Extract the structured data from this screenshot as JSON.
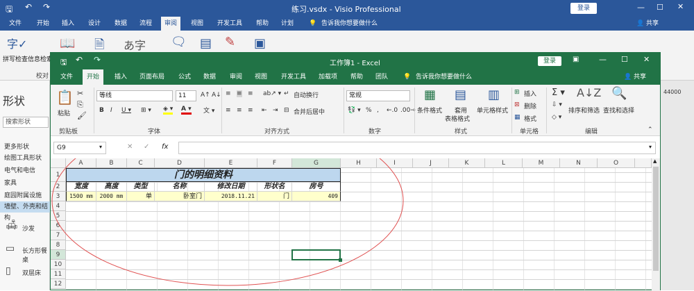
{
  "visio": {
    "title": "练习.vsdx - Visio Professional",
    "login": "登录",
    "share": "共享",
    "tell_me": "告诉我你想要做什么",
    "tabs": [
      "文件",
      "开始",
      "插入",
      "设计",
      "数据",
      "流程",
      "审阅",
      "视图",
      "开发工具",
      "帮助",
      "计划"
    ],
    "ribbon": {
      "spell": "拼写检查",
      "info": "信息检索",
      "group_label": "校对"
    },
    "shapes": {
      "title": "形状",
      "search_placeholder": "搜索形状",
      "items": [
        "更多形状",
        "绘图工具形状",
        "电气和电信",
        "家具",
        "庭园附属设施",
        "墙壁、外壳和结构"
      ],
      "stencil": [
        {
          "label": "沙发"
        },
        {
          "label": "长方形餐桌"
        },
        {
          "label": "双层床"
        }
      ]
    },
    "ruler_label": "44000"
  },
  "excel": {
    "title": "工作簿1 - Excel",
    "login": "登录",
    "share": "共享",
    "tell_me": "告诉我你想要做什么",
    "tabs": [
      "文件",
      "开始",
      "插入",
      "页面布局",
      "公式",
      "数据",
      "审阅",
      "视图",
      "开发工具",
      "加载项",
      "帮助",
      "团队"
    ],
    "font_name": "等线",
    "font_size": "11",
    "number_format": "常规",
    "ribbon": {
      "paste": "粘贴",
      "wrap": "自动换行",
      "merge": "合并后居中",
      "cond_format": "条件格式",
      "table_format_1": "套用",
      "table_format_2": "表格格式",
      "cell_style": "单元格样式",
      "insert": "插入",
      "delete": "删除",
      "format": "格式",
      "sort": "排序和筛选",
      "find": "查找和选择",
      "groups": [
        "剪贴板",
        "字体",
        "对齐方式",
        "数字",
        "样式",
        "单元格",
        "编辑"
      ]
    },
    "name_box": "G9",
    "formula": "",
    "columns": [
      "A",
      "B",
      "C",
      "D",
      "E",
      "F",
      "G",
      "H",
      "I",
      "J",
      "K",
      "L",
      "M",
      "N",
      "O"
    ],
    "rows": [
      "1",
      "2",
      "3",
      "4",
      "5",
      "6",
      "7",
      "8",
      "9",
      "10",
      "11",
      "12"
    ],
    "sheet": {
      "title": "门的明细资料",
      "headers": [
        "宽度",
        "高度",
        "类型",
        "名称",
        "修改日期",
        "形状名",
        "房号"
      ],
      "row": [
        "1500 mm",
        "2000 mm",
        "单",
        "卧室门",
        "2018.11.21",
        "门",
        "409"
      ]
    }
  },
  "colors": {
    "visio": "#2b579a",
    "excel": "#217346",
    "header_fill": "#bdd7ee",
    "row_fill": "#ffffcc",
    "annotation": "#e05050"
  }
}
